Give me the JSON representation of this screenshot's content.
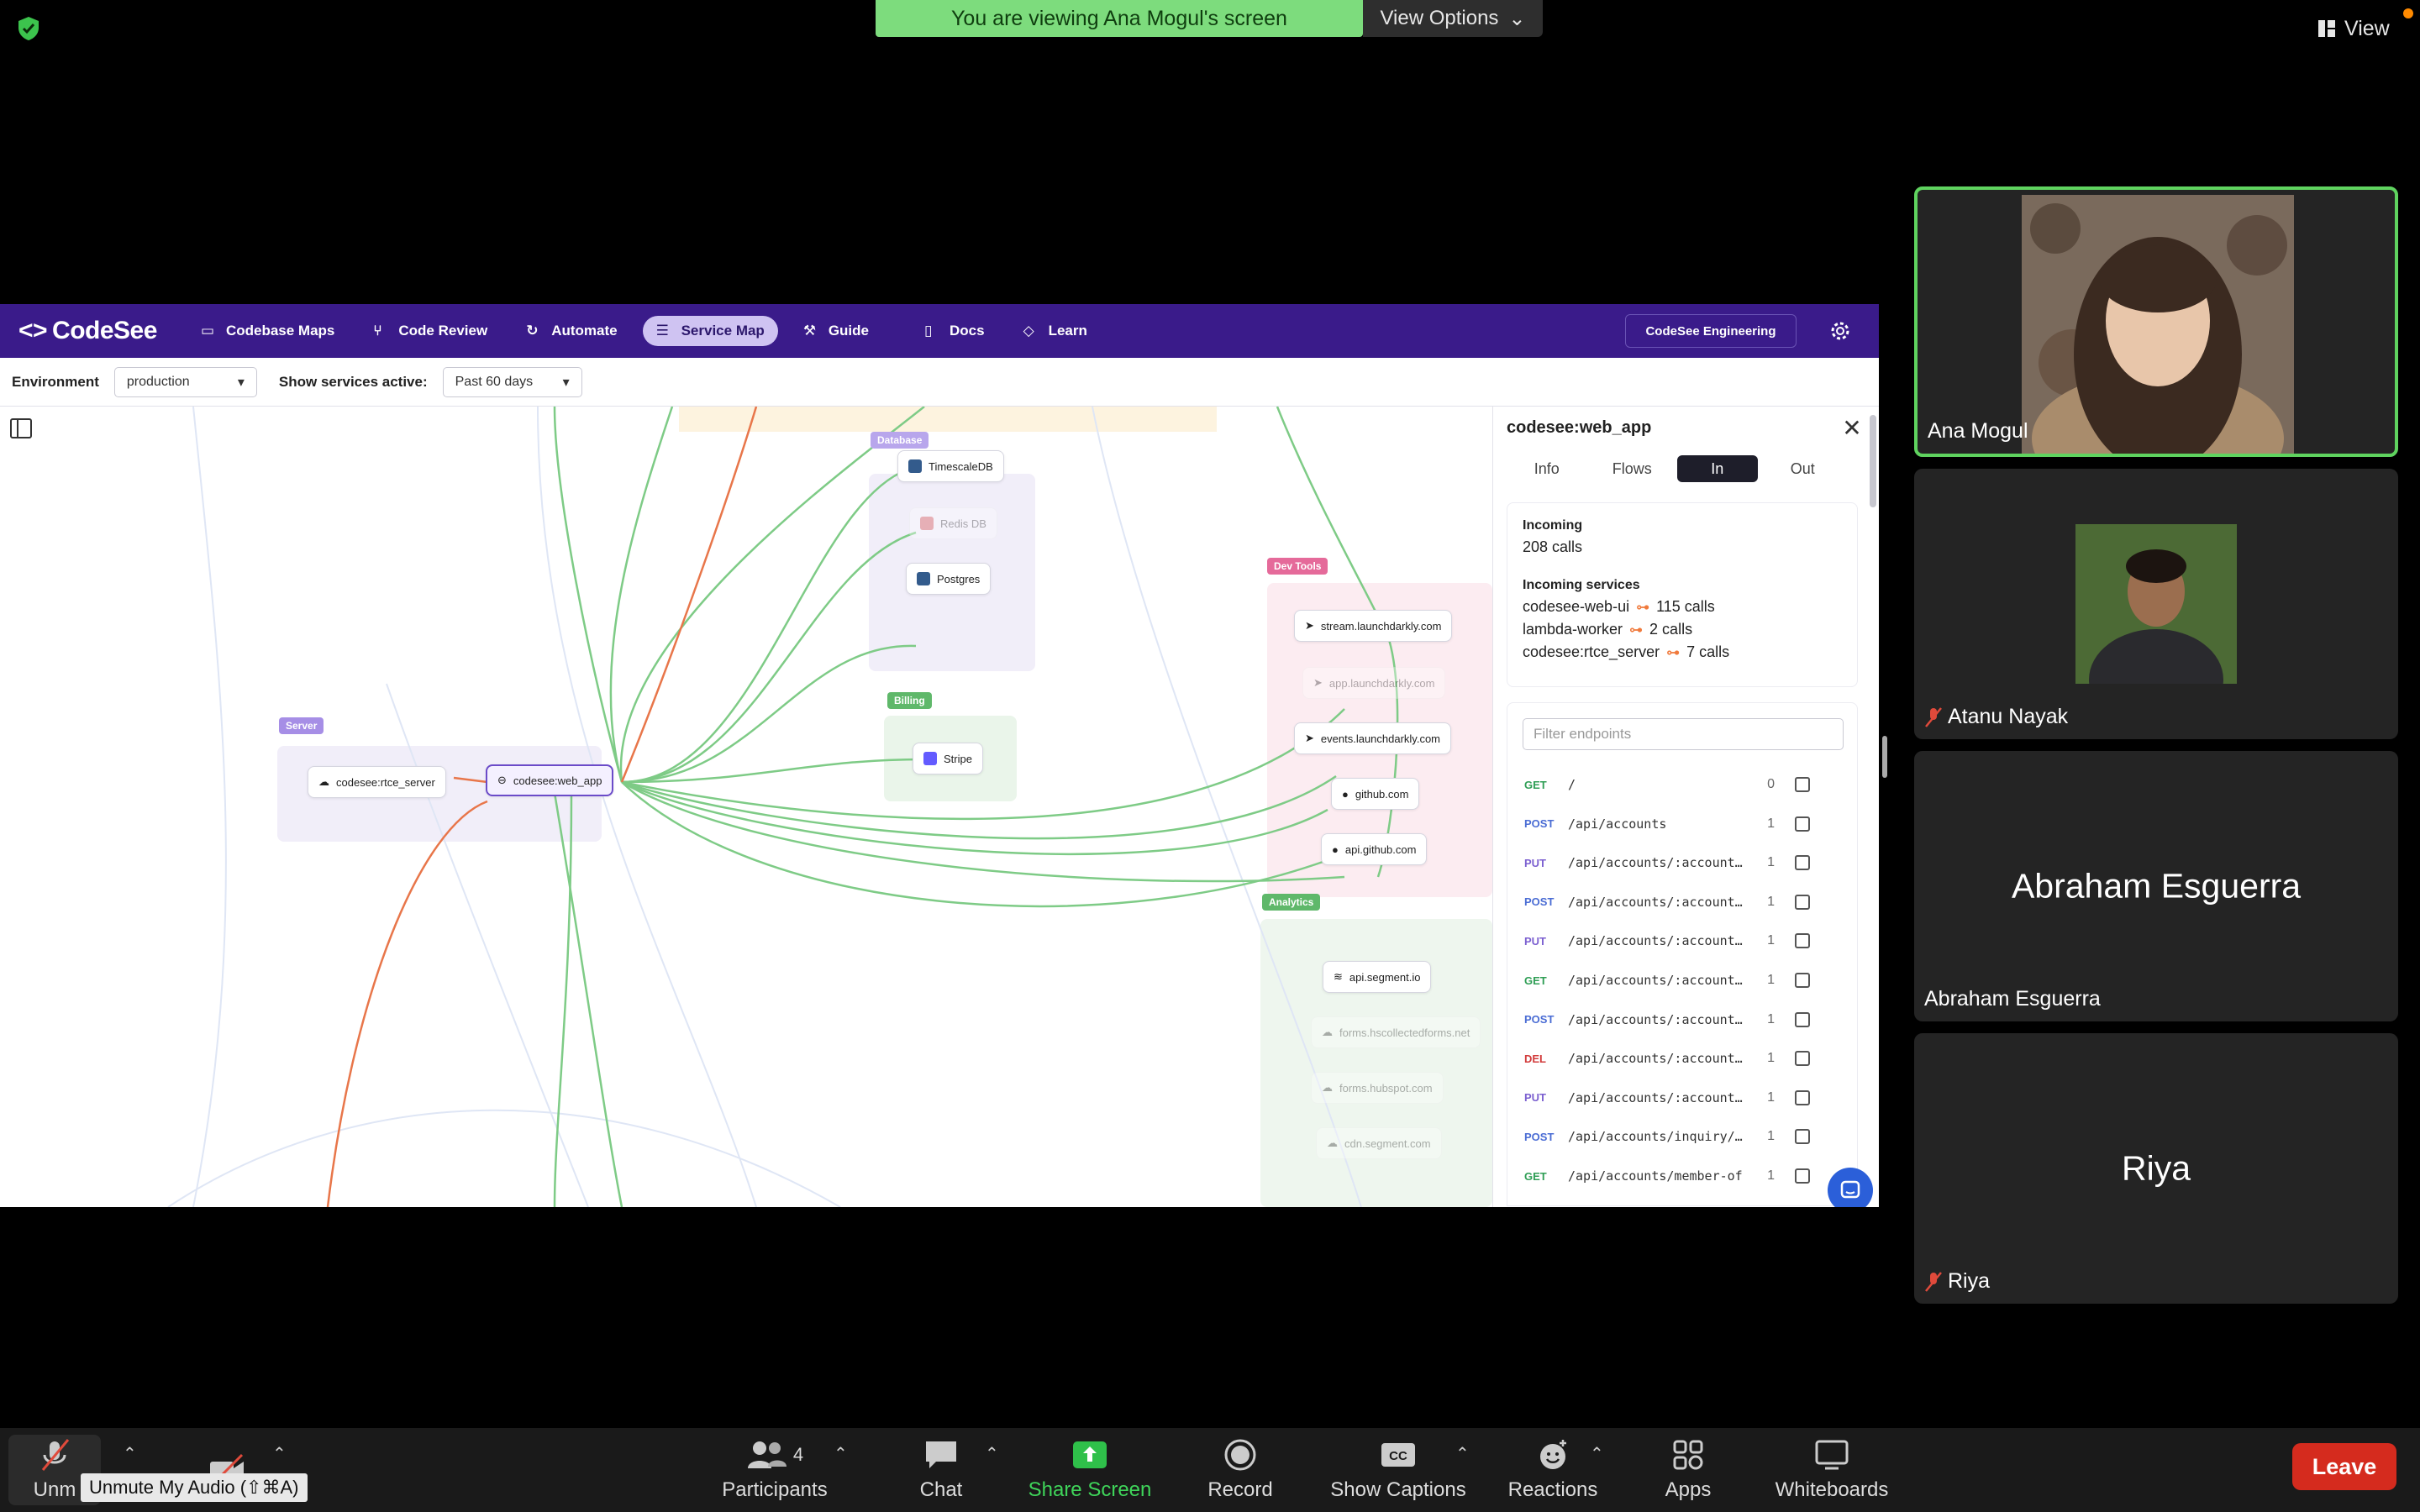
{
  "zoom": {
    "banner_text": "You are viewing Ana Mogul's screen",
    "view_options_label": "View Options",
    "view_label": "View",
    "tooltip": "Unmute My Audio (⇧⌘A)",
    "leave_label": "Leave",
    "toolbar": {
      "unmute_label": "Unm",
      "participants_label": "Participants",
      "participants_count": "4",
      "chat_label": "Chat",
      "share_label": "Share Screen",
      "record_label": "Record",
      "captions_label": "Show Captions",
      "reactions_label": "Reactions",
      "apps_label": "Apps",
      "whiteboards_label": "Whiteboards"
    },
    "participants": [
      {
        "name": "Ana Mogul",
        "video": true,
        "active": true,
        "muted": false
      },
      {
        "name": "Atanu Nayak",
        "video": true,
        "active": false,
        "muted": true
      },
      {
        "name": "Abraham Esguerra",
        "video": false,
        "active": false,
        "muted": false
      },
      {
        "name": "Riya",
        "video": false,
        "active": false,
        "muted": true
      }
    ]
  },
  "codesee": {
    "logo": "CodeSee",
    "nav": [
      "Codebase Maps",
      "Code Review",
      "Automate",
      "Service Map",
      "Guide",
      "Docs",
      "Learn"
    ],
    "active_nav": "Service Map",
    "org": "CodeSee Engineering",
    "environment_label": "Environment",
    "environment_value": "production",
    "active_label": "Show services active:",
    "active_value": "Past 60 days",
    "groups": {
      "database": "Database",
      "devtools": "Dev Tools",
      "server": "Server",
      "billing": "Billing",
      "analytics": "Analytics"
    },
    "nodes": {
      "timescale": "TimescaleDB",
      "redis": "Redis DB",
      "postgres": "Postgres",
      "stripe": "Stripe",
      "rtce": "codesee:rtce_server",
      "webapp": "codesee:web_app",
      "ld_stream": "stream.launchdarkly.com",
      "ld_app": "app.launchdarkly.com",
      "ld_events": "events.launchdarkly.com",
      "github": "github.com",
      "api_github": "api.github.com",
      "segment": "api.segment.io",
      "forms_hs": "forms.hscollectedforms.net",
      "forms_hubspot": "forms.hubspot.com",
      "cdn_segment": "cdn.segment.com"
    },
    "panel": {
      "title": "codesee:web_app",
      "tabs": [
        "Info",
        "Flows",
        "In",
        "Out"
      ],
      "active_tab": "In",
      "incoming_label": "Incoming",
      "incoming_calls": "208 calls",
      "services_label": "Incoming services",
      "services": [
        {
          "name": "codesee-web-ui",
          "calls": "115 calls"
        },
        {
          "name": "lambda-worker",
          "calls": "2 calls"
        },
        {
          "name": "codesee:rtce_server",
          "calls": "7 calls"
        }
      ],
      "filter_placeholder": "Filter endpoints",
      "endpoints": [
        {
          "method": "GET",
          "path": "/",
          "count": "0"
        },
        {
          "method": "POST",
          "path": "/api/accounts",
          "count": "1"
        },
        {
          "method": "PUT",
          "path": "/api/accounts/:account…",
          "count": "1"
        },
        {
          "method": "POST",
          "path": "/api/accounts/:account…",
          "count": "1"
        },
        {
          "method": "PUT",
          "path": "/api/accounts/:account…",
          "count": "1"
        },
        {
          "method": "GET",
          "path": "/api/accounts/:account…",
          "count": "1"
        },
        {
          "method": "POST",
          "path": "/api/accounts/:account…",
          "count": "1"
        },
        {
          "method": "DEL",
          "path": "/api/accounts/:account…",
          "count": "1"
        },
        {
          "method": "PUT",
          "path": "/api/accounts/:account…",
          "count": "1"
        },
        {
          "method": "POST",
          "path": "/api/accounts/inquiry/…",
          "count": "1"
        },
        {
          "method": "GET",
          "path": "/api/accounts/member-of",
          "count": "1"
        }
      ]
    }
  },
  "colors": {
    "nav_bg": "#3a1b8a",
    "green_edge": "#7ecb86",
    "orange_edge": "#e8764a",
    "zoom_green": "#7ddc7d",
    "leave_red": "#d52b1e",
    "GET": "#2f9e55",
    "POST": "#4a6cd4",
    "PUT": "#7b5fd0",
    "DEL": "#d23b3b"
  }
}
